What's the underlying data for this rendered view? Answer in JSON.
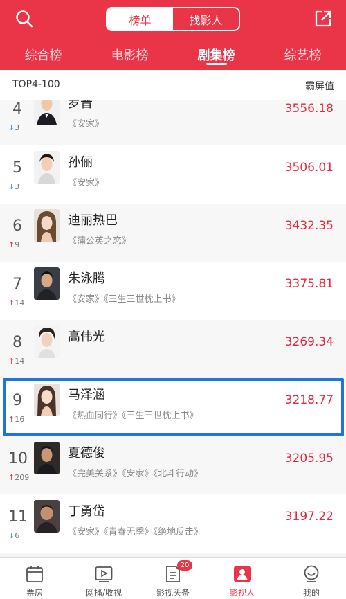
{
  "header": {
    "segments": [
      "榜单",
      "找影人"
    ],
    "active_segment": 0,
    "tabs": [
      "综合榜",
      "电影榜",
      "剧集榜",
      "综艺榜"
    ],
    "active_tab": 2,
    "accent_color": "#ea3448"
  },
  "subheader": {
    "left": "TOP4-100",
    "right": "霸屏值"
  },
  "rows": [
    {
      "rank": "4",
      "dir": "down",
      "change": "3",
      "name": "罗晋",
      "works": "《安家》",
      "score": "3556.18"
    },
    {
      "rank": "5",
      "dir": "down",
      "change": "3",
      "name": "孙俪",
      "works": "《安家》",
      "score": "3506.01"
    },
    {
      "rank": "6",
      "dir": "up",
      "change": "9",
      "name": "迪丽热巴",
      "works": "《蒲公英之恋》",
      "score": "3432.35"
    },
    {
      "rank": "7",
      "dir": "up",
      "change": "14",
      "name": "朱泳腾",
      "works": "《安家》《三生三世枕上书》",
      "score": "3375.81"
    },
    {
      "rank": "8",
      "dir": "up",
      "change": "14",
      "name": "高伟光",
      "works": "",
      "score": "3269.34"
    },
    {
      "rank": "9",
      "dir": "up",
      "change": "16",
      "name": "马泽涵",
      "works": "《热血同行》《三生三世枕上书》",
      "score": "3218.77"
    },
    {
      "rank": "10",
      "dir": "up",
      "change": "209",
      "name": "夏德俊",
      "works": "《完美关系》《安家》《北斗行动》",
      "score": "3205.95"
    },
    {
      "rank": "11",
      "dir": "down",
      "change": "6",
      "name": "丁勇岱",
      "works": "《安家》《青春无季》《绝地反击》",
      "score": "3197.22"
    }
  ],
  "bottom_nav": [
    {
      "label": "票房",
      "icon": "calendar-icon"
    },
    {
      "label": "网播/收视",
      "icon": "play-icon"
    },
    {
      "label": "影视头条",
      "icon": "news-icon",
      "badge": "20"
    },
    {
      "label": "影视人",
      "icon": "person-icon",
      "active": true
    },
    {
      "label": "我的",
      "icon": "profile-icon"
    }
  ],
  "highlight_color": "#1f73e3"
}
